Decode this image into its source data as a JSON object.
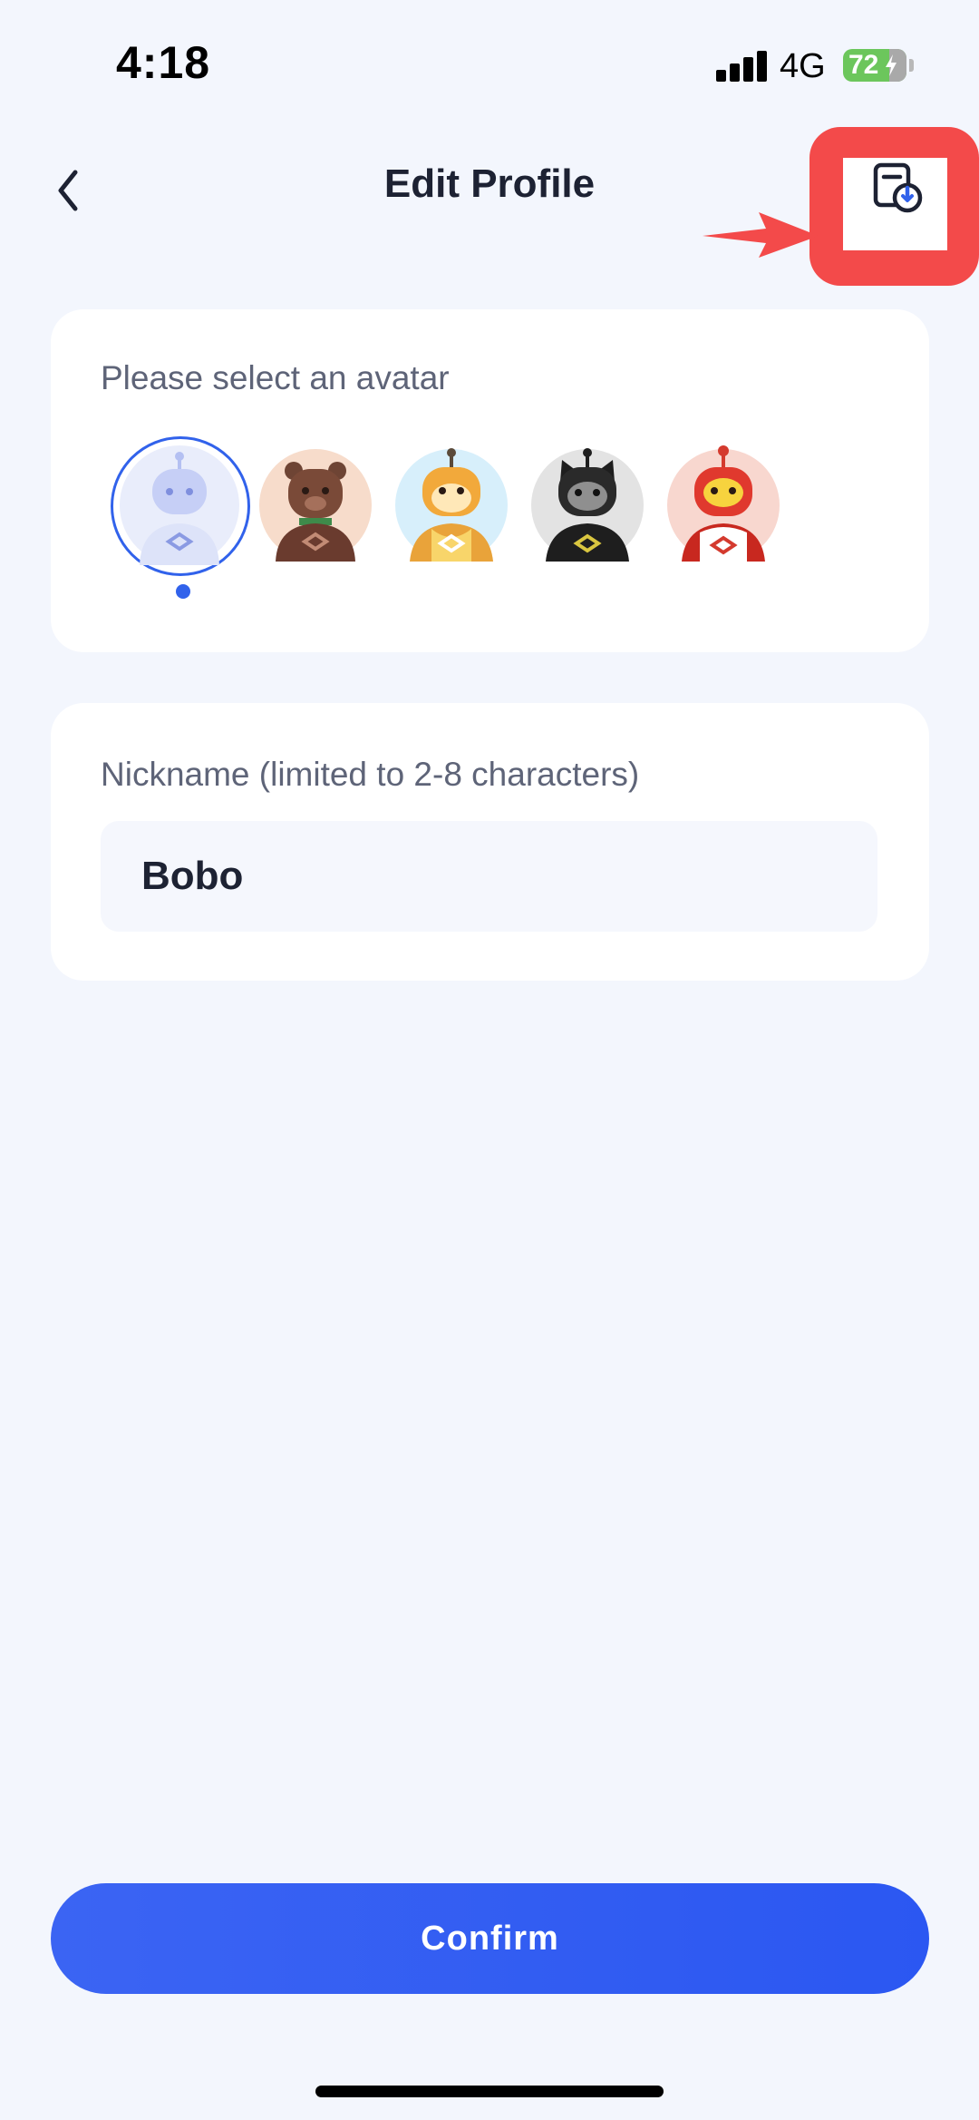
{
  "status_bar": {
    "time": "4:18",
    "network": "4G",
    "battery": "72"
  },
  "nav": {
    "title": "Edit Profile",
    "back_icon": "chevron-left-icon",
    "action_icon": "export-document-icon"
  },
  "avatar_section": {
    "label": "Please select an avatar",
    "selected_index": 0,
    "avatars": [
      {
        "name": "robot-blue",
        "bg": "#E9EDFB"
      },
      {
        "name": "bear-brown",
        "bg": "#F7DCCB"
      },
      {
        "name": "tiger-orange",
        "bg": "#D7EFFB"
      },
      {
        "name": "cat-black",
        "bg": "#E3E3E3"
      },
      {
        "name": "robot-red",
        "bg": "#F8D7CF"
      }
    ]
  },
  "nickname_section": {
    "label": "Nickname (limited to 2-8 characters)",
    "value": "Bobo"
  },
  "confirm_label": "Confirm",
  "colors": {
    "accent": "#3162EB",
    "highlight": "#F34A4A",
    "background": "#F3F6FD"
  }
}
